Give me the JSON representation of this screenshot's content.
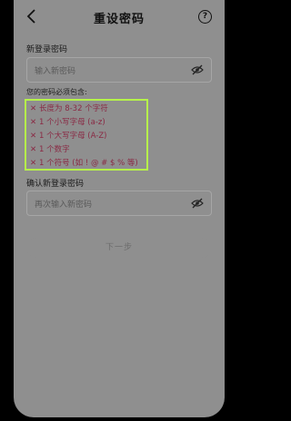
{
  "header": {
    "title": "重设密码",
    "back_icon": "chevron-left-icon",
    "help_label": "?"
  },
  "new_password": {
    "label": "新登录密码",
    "placeholder": "输入新密码",
    "visibility_icon": "eye-off-icon"
  },
  "requirements": {
    "title": "您的密码必须包含:",
    "mark": "✕",
    "items": [
      "长度为 8-32 个字符",
      "1 个小写字母 (a-z)",
      "1 个大写字母 (A-Z)",
      "1 个数字",
      "1 个符号 (如 ! @ # $ % 等)"
    ]
  },
  "confirm_password": {
    "label": "确认新登录密码",
    "placeholder": "再次输入新密码",
    "visibility_icon": "eye-off-icon"
  },
  "next_button": {
    "label": "下一步"
  },
  "colors": {
    "highlight_border": "#b6f34a",
    "requirement_text": "#8a2a44",
    "overlay_background": "#8f8f8f"
  }
}
